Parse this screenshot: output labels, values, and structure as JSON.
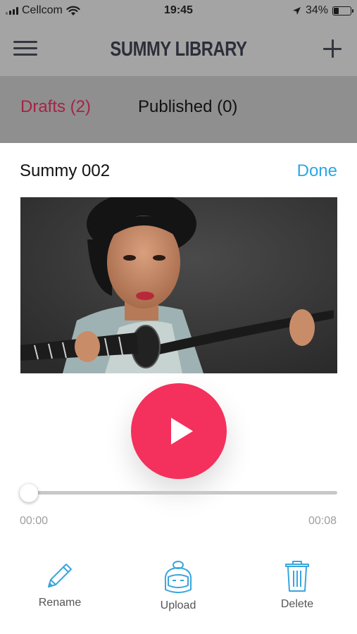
{
  "status_bar": {
    "carrier": "Cellcom",
    "time": "19:45",
    "battery_percent": "34%",
    "battery_level": 0.34,
    "icons": [
      "signal-bars-icon",
      "wifi-icon",
      "location-arrow-icon",
      "battery-icon"
    ]
  },
  "nav": {
    "title": "SUMMY LIBRARY",
    "menu_icon": "hamburger-menu-icon",
    "add_icon": "plus-icon"
  },
  "tabs": [
    {
      "label": "Drafts (2)",
      "active": true
    },
    {
      "label": "Published (0)",
      "active": false
    }
  ],
  "sheet": {
    "title": "Summy 002",
    "done_label": "Done"
  },
  "player": {
    "thumbnail": "woman-holding-katana-photo",
    "play_icon": "play-icon",
    "current_time": "00:00",
    "duration": "00:08",
    "progress": 0
  },
  "actions": [
    {
      "label": "Rename",
      "icon": "pencil-icon"
    },
    {
      "label": "Upload",
      "icon": "summy-mascot-icon"
    },
    {
      "label": "Delete",
      "icon": "trash-icon"
    }
  ],
  "colors": {
    "accent_pink": "#f4305d",
    "active_tab": "#a52445",
    "done_blue": "#29a8e6",
    "icon_blue": "#3aa6dc"
  }
}
